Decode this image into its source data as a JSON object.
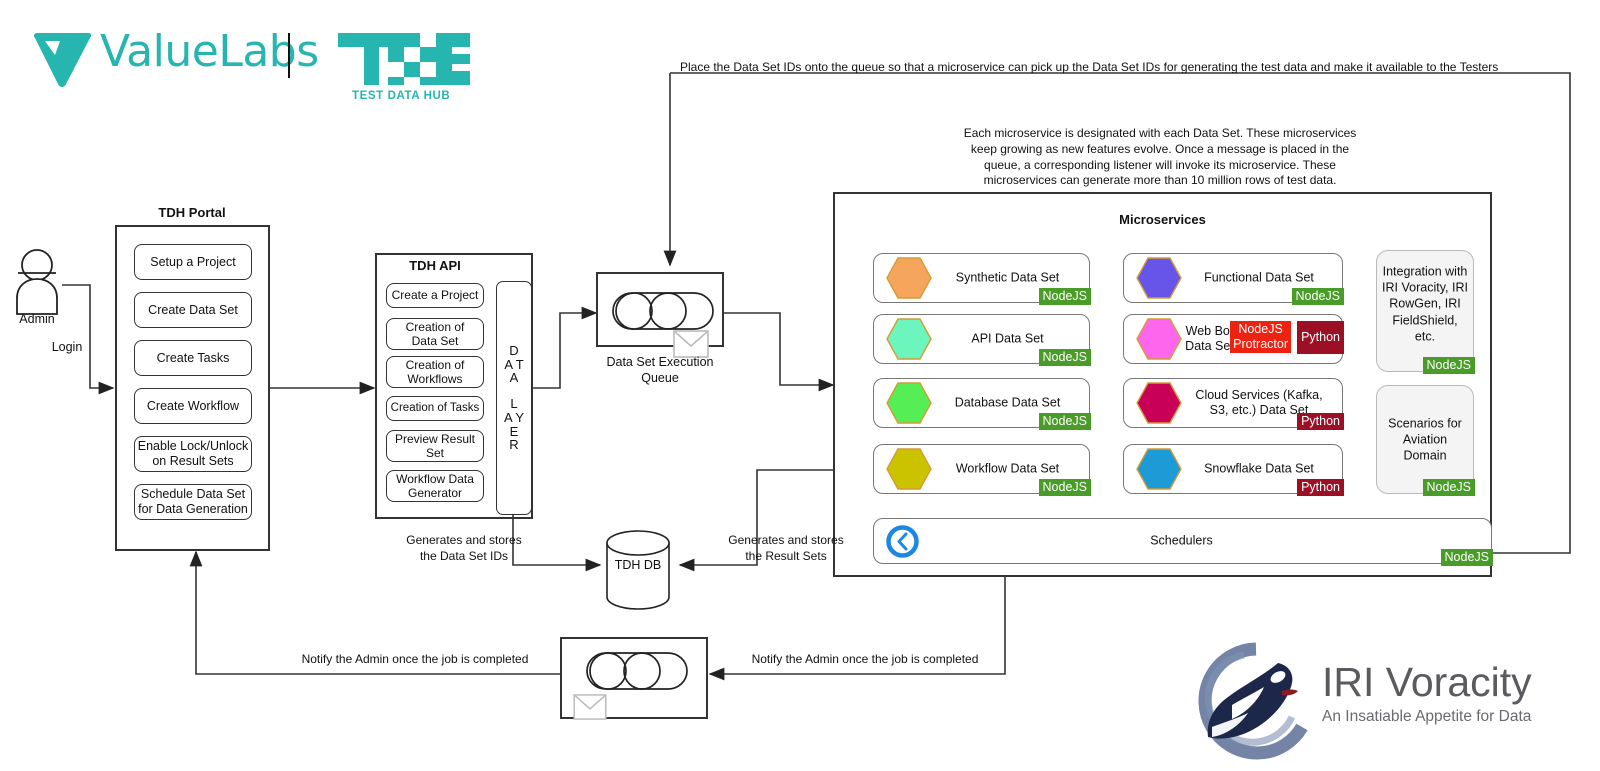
{
  "branding": {
    "valuelabs_name": "ValueLabs",
    "tdh_logo_sub": "TEST DATA HUB",
    "iri_name": "IRI Voracity",
    "iri_tagline": "An Insatiable Appetite for Data"
  },
  "actor": {
    "label": "Admin",
    "login_label": "Login"
  },
  "portal": {
    "title": "TDH Portal",
    "items": [
      "Setup a Project",
      "Create Data Set",
      "Create Tasks",
      "Create Workflow",
      "Enable Lock/Unlock\non Result Sets",
      "Schedule Data Set\nfor Data Generation"
    ]
  },
  "api": {
    "title": "TDH API",
    "items": [
      "Create a Project",
      "Creation of\nData Set",
      "Creation of\nWorkflows",
      "Creation of Tasks",
      "Preview Result\nSet",
      "Workflow Data\nGenerator"
    ],
    "data_layer_label": "DATA LAYER",
    "data_layer_lines": [
      "D",
      "A T",
      "A",
      "L",
      "A Y",
      "E",
      "R"
    ]
  },
  "queue": {
    "label": "Data Set Execution\nQueue",
    "icon": "queue-cylinder-icon",
    "envelope_icon": "envelope-icon"
  },
  "notify_queue": {
    "icon": "queue-cylinder-icon",
    "envelope_icon": "envelope-icon"
  },
  "database": {
    "label": "TDH DB",
    "icon": "database-cylinder-icon"
  },
  "microservices": {
    "title": "Microservices",
    "left_column": [
      {
        "label": "Synthetic Data Set",
        "hex_color": "#f5a65c",
        "tags": [
          {
            "text": "NodeJS",
            "kind": "node"
          }
        ]
      },
      {
        "label": "API Data Set",
        "hex_color": "#6cf5bc",
        "tags": [
          {
            "text": "NodeJS",
            "kind": "node"
          }
        ]
      },
      {
        "label": "Database Data Set",
        "hex_color": "#55ef55",
        "tags": [
          {
            "text": "NodeJS",
            "kind": "node"
          }
        ]
      },
      {
        "label": "Workflow Data Set",
        "hex_color": "#cbc300",
        "tags": [
          {
            "text": "NodeJS",
            "kind": "node"
          }
        ]
      }
    ],
    "right_column": [
      {
        "label": "Functional Data Set",
        "hex_color": "#6655e8",
        "tags": [
          {
            "text": "NodeJS",
            "kind": "node"
          }
        ]
      },
      {
        "label": "Web Bot\nData Set",
        "hex_color": "#ff66ee",
        "tags": [
          {
            "text": "NodeJS\nProtractor",
            "kind": "protractor"
          },
          {
            "text": "Python",
            "kind": "python"
          }
        ]
      },
      {
        "label": "Cloud Services (Kafka,\nS3, etc.) Data Set",
        "hex_color": "#c80058",
        "tags": [
          {
            "text": "Python",
            "kind": "python"
          }
        ]
      },
      {
        "label": "Snowflake Data Set",
        "hex_color": "#1d9bd7",
        "tags": [
          {
            "text": "Python",
            "kind": "python"
          }
        ]
      }
    ],
    "side_boxes": [
      {
        "label": "Integration with\nIRI Voracity, IRI\nRowGen, IRI\nFieldShield, etc.",
        "tag": "NodeJS"
      },
      {
        "label": "Scenarios for\nAviation Domain",
        "tag": "NodeJS"
      }
    ],
    "schedulers": {
      "label": "Schedulers",
      "tag": "NodeJS",
      "icon": "clock-icon"
    }
  },
  "annotations": {
    "queue_note": "Place the Data Set IDs onto the queue so that a microservice can pick up the Data Set IDs for generating the test data and make it available to the Testers",
    "microservices_note": "Each microservice is designated with each Data Set. These microservices\nkeep growing as new features evolve. Once a message is placed in the\nqueue, a corresponding listener will invoke its microservice. These\nmicroservices can generate more than 10 million rows of test data.",
    "store_ids": "Generates and stores\nthe Data Set IDs",
    "store_results": "Generates and stores\nthe Result Sets",
    "notify_left": "Notify the Admin once the job is completed",
    "notify_right": "Notify the Admin once the job is completed"
  },
  "colors": {
    "teal": "#27b5b0",
    "node_green": "#4a9c28",
    "python_red": "#9c1025",
    "protractor_red": "#ee2211",
    "line": "#333333",
    "iri_navy": "#1d2749",
    "iri_blue": "#5a6f96"
  }
}
